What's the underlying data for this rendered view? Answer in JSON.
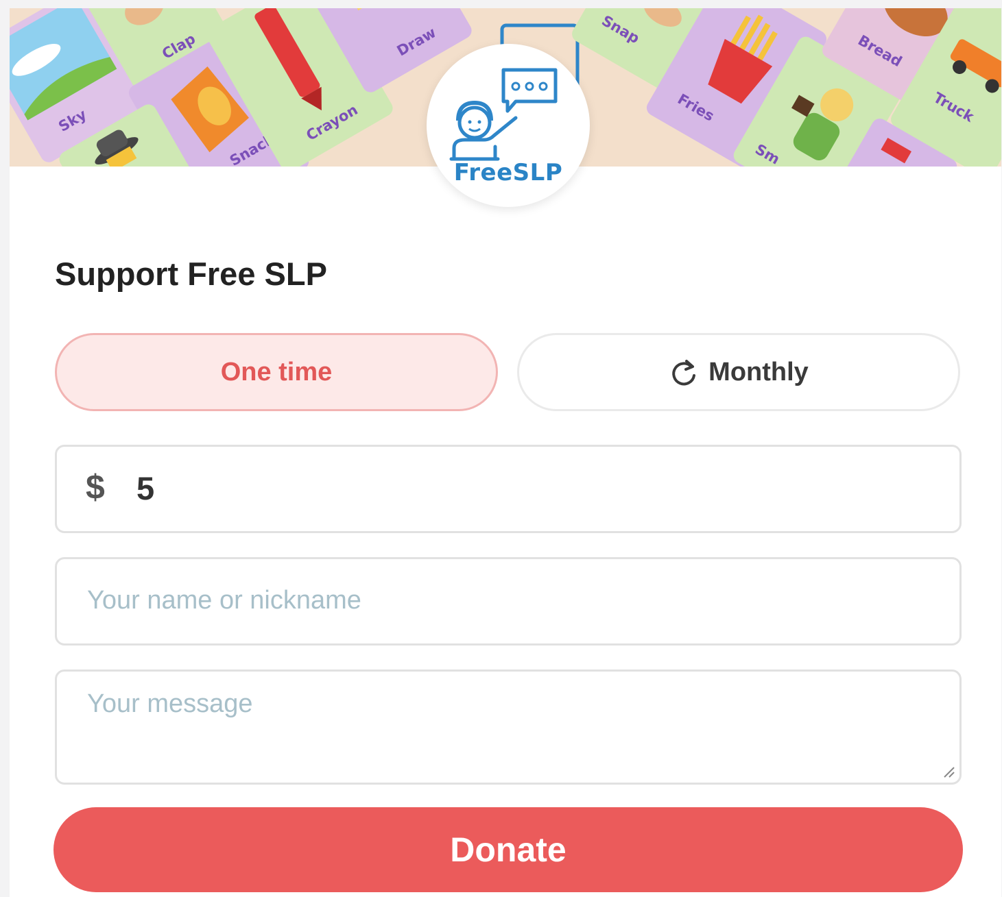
{
  "banner": {
    "cards": [
      "Sky",
      "Clap",
      "Crayon",
      "Draw",
      "Snack",
      "Snap",
      "Fries",
      "Bread",
      "Truck",
      "Sm"
    ]
  },
  "logo": {
    "text": "FreeSLP"
  },
  "form": {
    "title": "Support Free SLP",
    "one_time_label": "One time",
    "monthly_label": "Monthly",
    "selected_frequency": "One time",
    "currency_symbol": "$",
    "amount_value": "5",
    "name_placeholder": "Your name or nickname",
    "message_placeholder": "Your message",
    "donate_label": "Donate"
  },
  "colors": {
    "accent": "#eb5b5b",
    "active_pill_bg": "#fde9e8",
    "banner_bg": "#f3dfcb",
    "logo_blue": "#2a84c6"
  },
  "icons": {
    "monthly": "refresh-icon",
    "textarea": "resize-handle-icon"
  }
}
